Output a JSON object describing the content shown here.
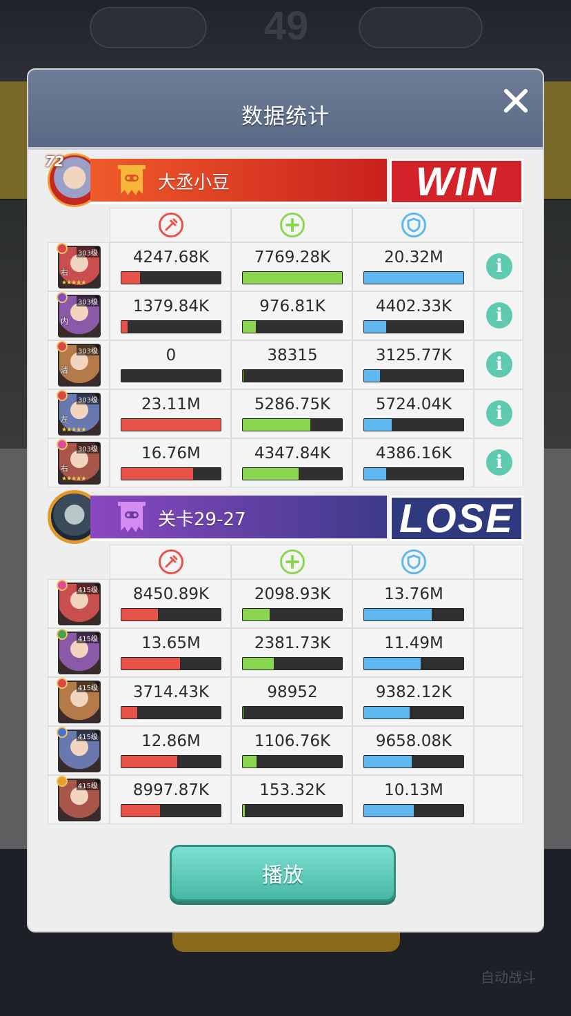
{
  "background": {
    "top_center_text": "49",
    "bottom_right_text": "自动战斗"
  },
  "modal": {
    "title": "数据统计",
    "close_icon": "close-icon",
    "play_button_label": "播放"
  },
  "stat_icons": {
    "damage": "sword-icon",
    "heal": "plus-icon",
    "defense": "shield-icon"
  },
  "colors": {
    "win_banner": "#d2222a",
    "lose_banner": "#2e3a7d",
    "damage_bar": "#e85349",
    "heal_bar": "#8bd650",
    "defense_bar": "#5fb7ef",
    "info_button": "#5ecbb0"
  },
  "team_win": {
    "player_level": "72",
    "name": "大丞小豆",
    "result": "WIN",
    "heroes": [
      {
        "level": "303级",
        "tag": "右",
        "stars": "★★★★★",
        "damage": "4247.68K",
        "damage_pct": 19,
        "heal": "7769.28K",
        "heal_pct": 100,
        "defense": "20.32M",
        "defense_pct": 100,
        "info": "i"
      },
      {
        "level": "303级",
        "tag": "内",
        "stars": "",
        "damage": "1379.84K",
        "damage_pct": 6,
        "heal": "976.81K",
        "heal_pct": 13,
        "defense": "4402.33K",
        "defense_pct": 22,
        "info": "i"
      },
      {
        "level": "303级",
        "tag": "清",
        "stars": "",
        "damage": "0",
        "damage_pct": 0,
        "heal": "38315",
        "heal_pct": 1,
        "defense": "3125.77K",
        "defense_pct": 16,
        "info": "i"
      },
      {
        "level": "303级",
        "tag": "左",
        "stars": "★★★★★",
        "damage": "23.11M",
        "damage_pct": 100,
        "heal": "5286.75K",
        "heal_pct": 68,
        "defense": "5724.04K",
        "defense_pct": 28,
        "info": "i"
      },
      {
        "level": "303级",
        "tag": "右",
        "stars": "★★★★★",
        "damage": "16.76M",
        "damage_pct": 72,
        "heal": "4347.84K",
        "heal_pct": 56,
        "defense": "4386.16K",
        "defense_pct": 22,
        "info": "i"
      }
    ]
  },
  "team_lose": {
    "name": "关卡29-27",
    "result": "LOSE",
    "heroes": [
      {
        "level": "415级",
        "damage": "8450.89K",
        "damage_pct": 37,
        "heal": "2098.93K",
        "heal_pct": 27,
        "defense": "13.76M",
        "defense_pct": 68
      },
      {
        "level": "415级",
        "damage": "13.65M",
        "damage_pct": 59,
        "heal": "2381.73K",
        "heal_pct": 31,
        "defense": "11.49M",
        "defense_pct": 57
      },
      {
        "level": "415级",
        "damage": "3714.43K",
        "damage_pct": 16,
        "heal": "98952",
        "heal_pct": 1,
        "defense": "9382.12K",
        "defense_pct": 46
      },
      {
        "level": "415级",
        "damage": "12.86M",
        "damage_pct": 56,
        "heal": "1106.76K",
        "heal_pct": 14,
        "defense": "9658.08K",
        "defense_pct": 48
      },
      {
        "level": "415级",
        "damage": "8997.87K",
        "damage_pct": 39,
        "heal": "153.32K",
        "heal_pct": 2,
        "defense": "10.13M",
        "defense_pct": 50
      }
    ]
  }
}
